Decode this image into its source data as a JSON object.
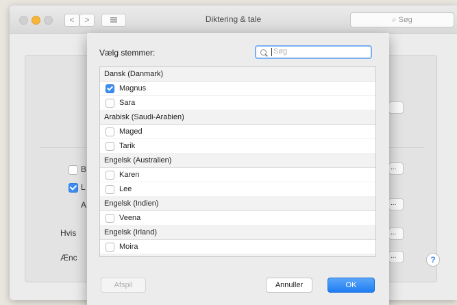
{
  "window": {
    "title": "Diktering & tale",
    "search_placeholder": "Søg",
    "back_glyph": "<",
    "forward_glyph": ">"
  },
  "background_fragments": {
    "row1_letter": "B",
    "row2_letter": "L",
    "row3_letter": "A",
    "row4_text": "Hvis",
    "row5_text": "Ænc",
    "button_dots": "...",
    "help_glyph": "?"
  },
  "sheet": {
    "label": "Vælg stemmer:",
    "search_placeholder": "Søg",
    "groups": [
      {
        "name": "Dansk (Danmark)",
        "voices": [
          {
            "name": "Magnus",
            "checked": true
          },
          {
            "name": "Sara",
            "checked": false
          }
        ]
      },
      {
        "name": "Arabisk (Saudi-Arabien)",
        "voices": [
          {
            "name": "Maged",
            "checked": false
          },
          {
            "name": "Tarik",
            "checked": false
          }
        ]
      },
      {
        "name": "Engelsk (Australien)",
        "voices": [
          {
            "name": "Karen",
            "checked": false
          },
          {
            "name": "Lee",
            "checked": false
          }
        ]
      },
      {
        "name": "Engelsk (Indien)",
        "voices": [
          {
            "name": "Veena",
            "checked": false
          }
        ]
      },
      {
        "name": "Engelsk (Irland)",
        "voices": [
          {
            "name": "Moira",
            "checked": false
          }
        ]
      }
    ],
    "buttons": {
      "play": "Afspil",
      "cancel": "Annuller",
      "ok": "OK"
    }
  },
  "colors": {
    "accent": "#3c8cf2",
    "ok_button": "#1f7ef2"
  }
}
